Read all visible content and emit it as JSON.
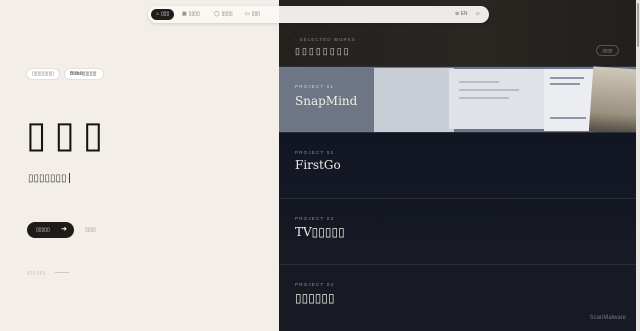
{
  "nav": {
    "items": [
      {
        "label": "▯▯▯",
        "icon": "home-icon",
        "active": true
      },
      {
        "label": "▯▯▯▯",
        "icon": "grid-icon",
        "active": false
      },
      {
        "label": "▯▯▯▯",
        "icon": "user-icon",
        "active": false
      },
      {
        "label": "▯▯▯",
        "icon": "calendar-icon",
        "active": false
      }
    ],
    "lang": "EN",
    "theme_icon": "sun-icon"
  },
  "left": {
    "pill_a": "▯▯▯▯▯▯▯▯",
    "pill_b": "Bilibili▯▯▯▯▯",
    "hero_name": "▯▯▯",
    "subline": "▯▯▯▯▯▯▯",
    "cta": "▯▯▯▯▯",
    "cta_ghost": "▯▯▯▯",
    "footnote": "▯▯▯▯▯▯"
  },
  "selected": {
    "kicker": "· SELECTED WORKS ·",
    "title": "▯▯▯▯▯▯▯▯",
    "button": "▯▯▯▯"
  },
  "projects": [
    {
      "num": "PROJECT 01",
      "name": "SnapMind"
    },
    {
      "num": "PROJECT 02",
      "name": "FirstGo"
    },
    {
      "num": "PROJECT 03",
      "name": "TV▯▯▯▯▯"
    },
    {
      "num": "PROJECT 04",
      "name": "▯▯▯▯▯▯"
    }
  ],
  "watermark": "ScanMalware"
}
